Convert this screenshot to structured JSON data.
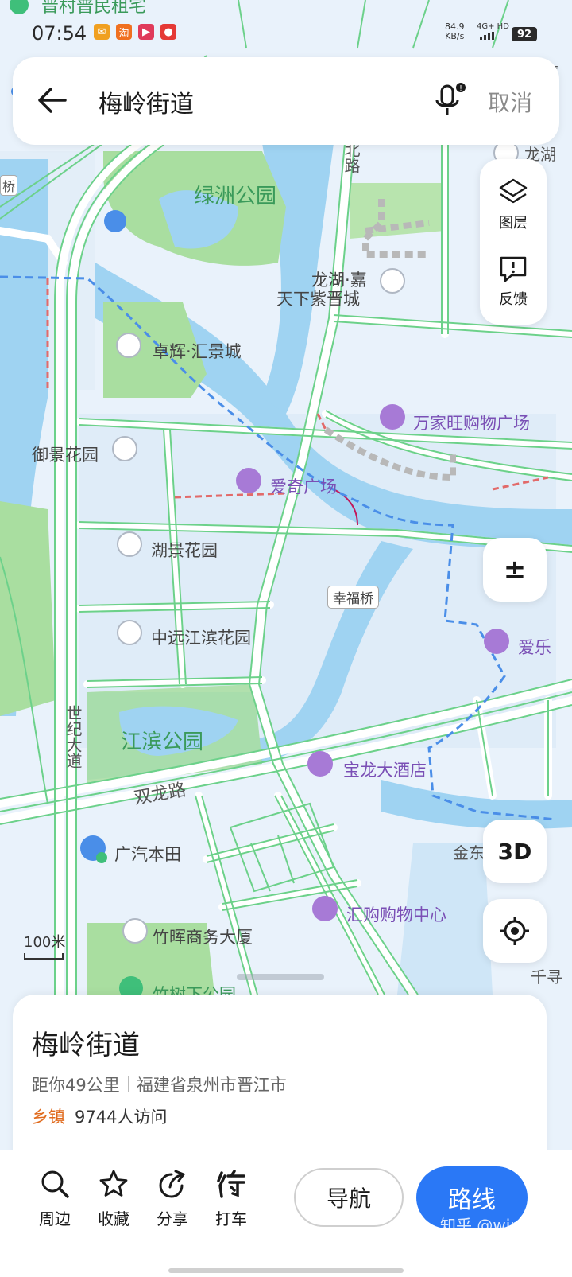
{
  "status_bar": {
    "time": "07:54",
    "network_speed": "84.9",
    "network_unit": "KB/s",
    "signal": "4G+ HD",
    "battery": "92"
  },
  "search": {
    "query": "梅岭街道",
    "cancel_label": "取消"
  },
  "map_controls": {
    "layers_label": "图层",
    "feedback_label": "反馈",
    "zoom_label": "±",
    "view_3d_label": "3D",
    "scale_label": "100米"
  },
  "map_labels": {
    "top_cut": "晋村普民租宅",
    "top_right_cut": "厦",
    "bridge_left": "桥",
    "longhu_cut": "龙湖",
    "bei_road": "北路",
    "lvzhou_park": "绿洲公园",
    "longhu_jia": "龙湖·嘉",
    "tianxia_zijin": "天下紫晋城",
    "zhuohui": "卓辉·汇景城",
    "wanjiawang": "万家旺购物广场",
    "yujing": "御景花园",
    "aiqi": "爱奇广场",
    "hujing": "湖景花园",
    "xingfu_bridge": "幸福桥",
    "aile": "爱乐",
    "zhongyuan": "中远江滨花园",
    "shiji_road": "世纪大道",
    "jiangbin_park": "江滨公园",
    "baolong": "宝龙大酒店",
    "shuanglong_road": "双龙路",
    "guangqi": "广汽本田",
    "jin_cut": "金东",
    "huigou": "汇购购物中心",
    "zhuhui": "竹晖商务大厦",
    "zhushuxia": "竹树下公园",
    "qian_cut": "千寻"
  },
  "place_card": {
    "title": "梅岭街道",
    "distance": "距你49公里",
    "address": "福建省泉州市晋江市",
    "category": "乡镇",
    "visits": "9744人访问"
  },
  "bottom_bar": {
    "nearby": "周边",
    "favorite": "收藏",
    "share": "分享",
    "taxi": "打车",
    "navigate": "导航",
    "route": "路线",
    "watermark": "知乎 @winter"
  },
  "colors": {
    "water": "#9fd3f2",
    "park": "#a9dea0",
    "road_edge": "#6cd18a",
    "boundary": "#4a8ee8",
    "route_blue": "#2a78f6",
    "poi_purple": "#a77ad6",
    "category_orange": "#e06a1c"
  },
  "icons": [
    "back-arrow-icon",
    "mic-icon",
    "layers-icon",
    "feedback-icon",
    "zoom-icon",
    "locate-icon",
    "search-icon",
    "star-icon",
    "share-icon",
    "taxi-icon"
  ]
}
